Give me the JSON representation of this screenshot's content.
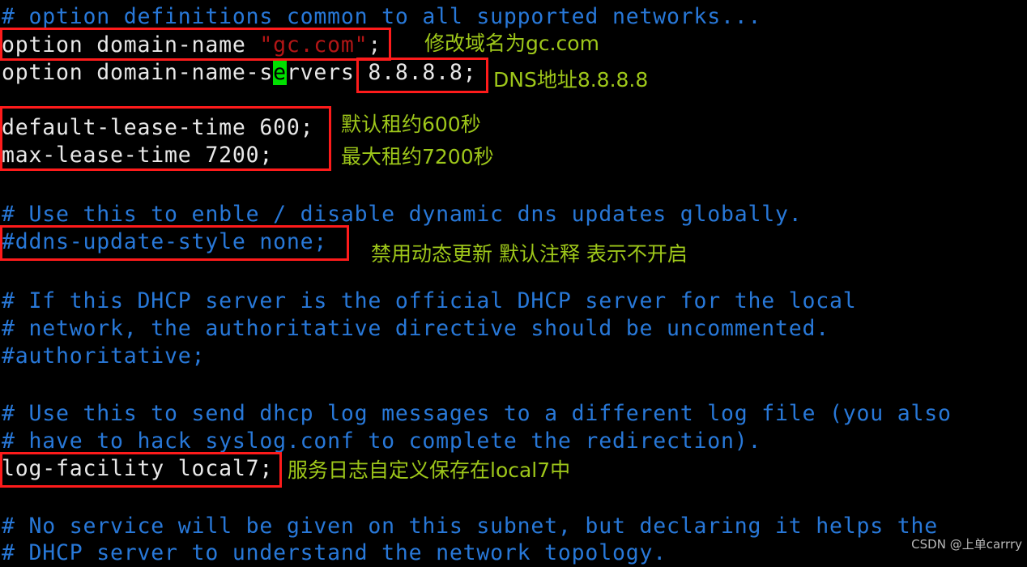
{
  "terminal": {
    "background": "#000000",
    "comment_color": "#2878d8",
    "text_color": "#e8e8e8",
    "string_color": "#b31616",
    "cursor_color": "#00e000",
    "highlight_box_color": "#fe1b1b",
    "annotation_color": "#9ec71a",
    "lines": {
      "l1": "# option definitions common to all supported networks...",
      "l2_a": "option domain-name ",
      "l2_b": "\"gc.com\"",
      "l2_c": ";",
      "l3_a": "option domain-name-s",
      "l3_cursor": "e",
      "l3_b": "rvers 8.8.8.8;",
      "l4": "default-lease-time 600;",
      "l5": "max-lease-time 7200;",
      "l6": "# Use this to enble / disable dynamic dns updates globally.",
      "l7": "#ddns-update-style none;",
      "l8": "# If this DHCP server is the official DHCP server for the local",
      "l9": "# network, the authoritative directive should be uncommented.",
      "l10": "#authoritative;",
      "l11": "# Use this to send dhcp log messages to a different log file (you also",
      "l12": "# have to hack syslog.conf to complete the redirection).",
      "l13": "log-facility local7;",
      "l14": "# No service will be given on this subnet, but declaring it helps the",
      "l15": "# DHCP server to understand the network topology."
    }
  },
  "annotations": {
    "domain_name": "修改域名为gc.com",
    "dns_address": "DNS地址8.8.8.8",
    "default_lease": "默认租约600秒",
    "max_lease": "最大租约7200秒",
    "ddns": "禁用动态更新 默认注释 表示不开启",
    "log_facility": "服务日志自定义保存在local7中"
  },
  "watermark": {
    "text": "CSDN @上单carrry"
  }
}
